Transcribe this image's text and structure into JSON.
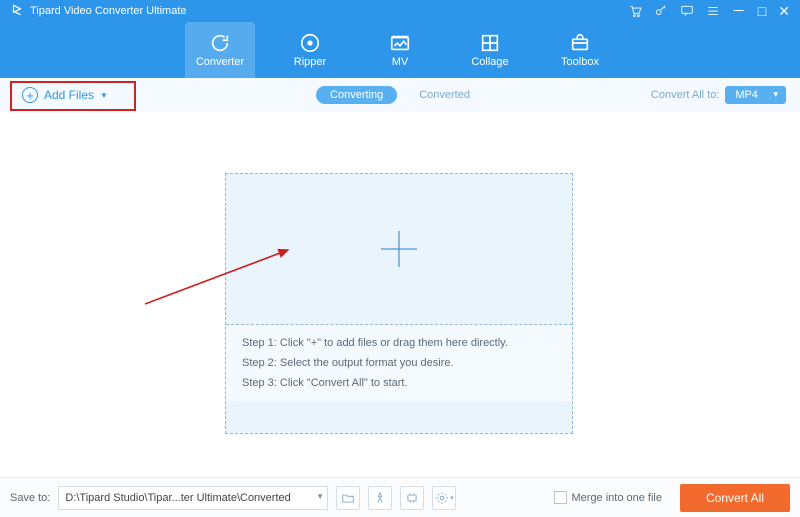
{
  "app": {
    "title": "Tipard Video Converter Ultimate"
  },
  "nav": {
    "items": [
      {
        "label": "Converter",
        "icon": "refresh"
      },
      {
        "label": "Ripper",
        "icon": "disc"
      },
      {
        "label": "MV",
        "icon": "image"
      },
      {
        "label": "Collage",
        "icon": "collage"
      },
      {
        "label": "Toolbox",
        "icon": "toolbox"
      }
    ]
  },
  "subbar": {
    "add_files_label": "Add Files",
    "tabs": {
      "converting": "Converting",
      "converted": "Converted"
    },
    "convert_all_label": "Convert All to:",
    "convert_all_value": "MP4"
  },
  "dropzone": {
    "step1": "Step 1: Click \"+\" to add files or drag them here directly.",
    "step2": "Step 2: Select the output format you desire.",
    "step3": "Step 3: Click \"Convert All\" to start."
  },
  "bottom": {
    "save_to_label": "Save to:",
    "save_path": "D:\\Tipard Studio\\Tipar...ter Ultimate\\Converted",
    "merge_label": "Merge into one file",
    "convert_button": "Convert All"
  }
}
